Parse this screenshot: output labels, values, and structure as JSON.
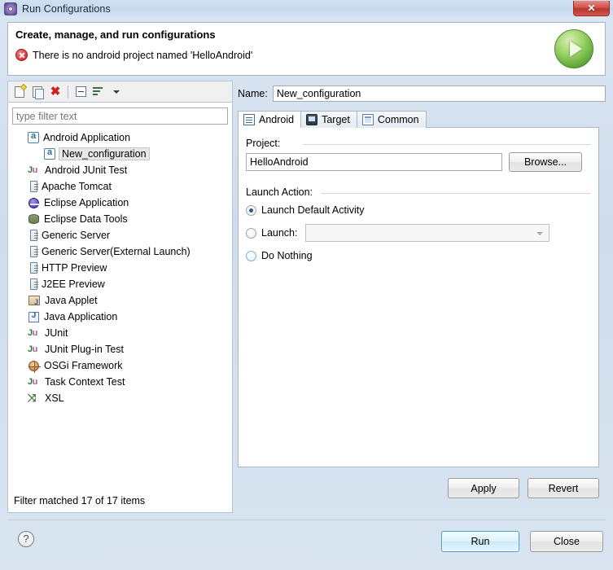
{
  "window": {
    "title": "Run Configurations",
    "title_icon": "gear-icon",
    "close_label": "✕"
  },
  "header": {
    "title": "Create, manage, and run configurations",
    "error_message": "There is no android project named 'HelloAndroid'",
    "error_icon": "error-x-icon",
    "run_badge_icon": "run-play-icon"
  },
  "left_panel": {
    "toolbar": {
      "new_label": "new-launch-configuration",
      "duplicate_label": "duplicate-launch-configuration",
      "delete_label": "delete-launch-configuration",
      "collapse_label": "collapse-all",
      "filter_label": "filter-launch-configurations",
      "menu_label": "view-menu"
    },
    "filter": {
      "value": "",
      "placeholder": "type filter text"
    },
    "tree": [
      {
        "label": "Android Application",
        "icon": "android-icon",
        "level": 0,
        "selected": false
      },
      {
        "label": "New_configuration",
        "icon": "android-icon",
        "level": 1,
        "selected": true
      },
      {
        "label": "Android JUnit Test",
        "icon": "junit-icon",
        "level": 0,
        "selected": false
      },
      {
        "label": "Apache Tomcat",
        "icon": "server-icon",
        "level": 0,
        "selected": false
      },
      {
        "label": "Eclipse Application",
        "icon": "eclipse-icon",
        "level": 0,
        "selected": false
      },
      {
        "label": "Eclipse Data Tools",
        "icon": "database-icon",
        "level": 0,
        "selected": false
      },
      {
        "label": "Generic Server",
        "icon": "server-icon",
        "level": 0,
        "selected": false
      },
      {
        "label": "Generic Server(External Launch)",
        "icon": "server-icon",
        "level": 0,
        "selected": false
      },
      {
        "label": "HTTP Preview",
        "icon": "server-icon",
        "level": 0,
        "selected": false
      },
      {
        "label": "J2EE Preview",
        "icon": "server-icon",
        "level": 0,
        "selected": false
      },
      {
        "label": "Java Applet",
        "icon": "java-applet-icon",
        "level": 0,
        "selected": false
      },
      {
        "label": "Java Application",
        "icon": "java-application-icon",
        "level": 0,
        "selected": false
      },
      {
        "label": "JUnit",
        "icon": "junit-icon",
        "level": 0,
        "selected": false
      },
      {
        "label": "JUnit Plug-in Test",
        "icon": "junit-plugin-icon",
        "level": 0,
        "selected": false
      },
      {
        "label": "OSGi Framework",
        "icon": "osgi-icon",
        "level": 0,
        "selected": false
      },
      {
        "label": "Task Context Test",
        "icon": "junit-icon",
        "level": 0,
        "selected": false
      },
      {
        "label": "XSL",
        "icon": "xsl-icon",
        "level": 0,
        "selected": false
      }
    ],
    "status": "Filter matched 17 of 17 items"
  },
  "right_panel": {
    "name_label": "Name:",
    "name_value": "New_configuration",
    "tabs": [
      {
        "label": "Android",
        "icon": "document-icon",
        "active": true
      },
      {
        "label": "Target",
        "icon": "monitor-icon",
        "active": false
      },
      {
        "label": "Common",
        "icon": "common-icon",
        "active": false
      }
    ],
    "project_group_label": "Project:",
    "project_value": "HelloAndroid",
    "browse_label": "Browse...",
    "launch_action_label": "Launch Action:",
    "radios": [
      {
        "label": "Launch Default Activity",
        "checked": true
      },
      {
        "label": "Launch:",
        "checked": false
      },
      {
        "label": "Do Nothing",
        "checked": false
      }
    ],
    "launch_combo_value": "",
    "apply_label": "Apply",
    "revert_label": "Revert"
  },
  "footer": {
    "help_icon": "help-question-icon",
    "run_label": "Run",
    "close_label": "Close"
  },
  "colors": {
    "accent": "#3ba3cf",
    "error": "#d2332b",
    "run_green": "#63ab3e",
    "titlebar": "#cfe0f0"
  }
}
